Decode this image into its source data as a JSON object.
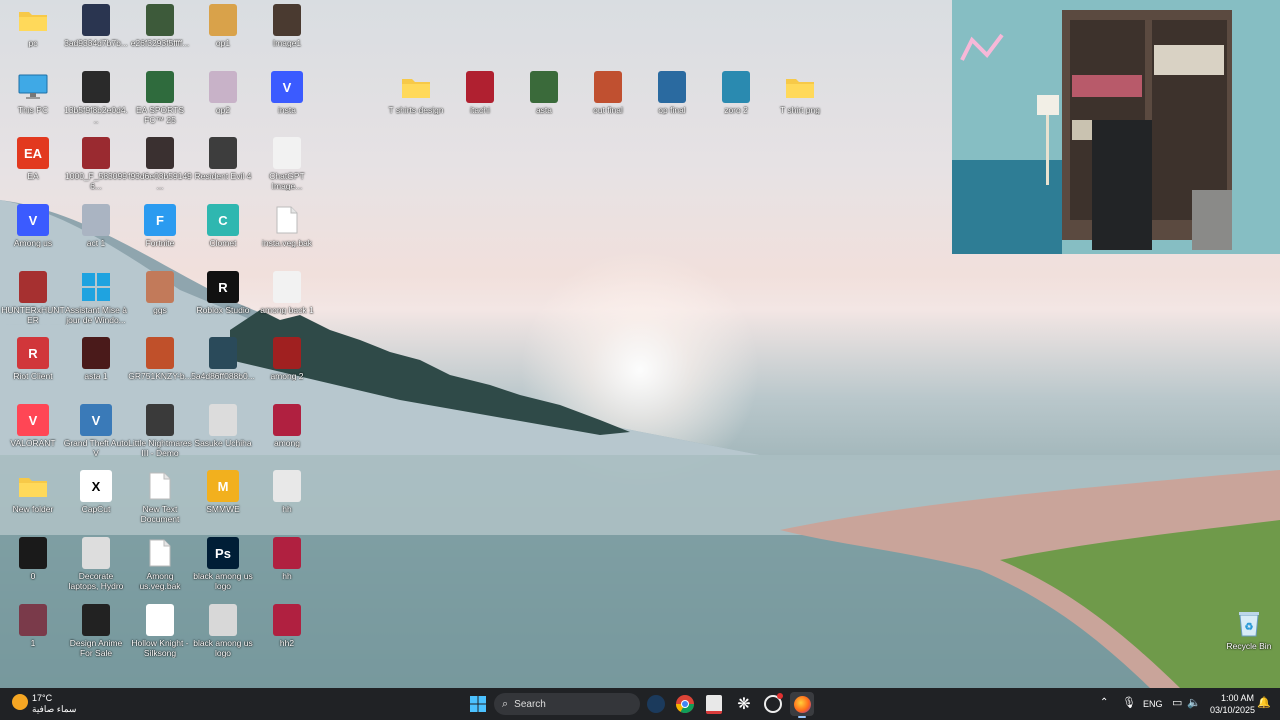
{
  "desktop": {
    "icons": [
      {
        "label": "pc",
        "type": "folder"
      },
      {
        "label": "3ad9334d7b7b...",
        "type": "image",
        "color": "#2a3550"
      },
      {
        "label": "e26f3293f5ffff...",
        "type": "image",
        "color": "#3d5a3a"
      },
      {
        "label": "op1",
        "type": "image",
        "color": "#d9a24a"
      },
      {
        "label": "Image1",
        "type": "image",
        "color": "#4a3a30"
      },
      {
        "label": "This PC",
        "type": "monitor"
      },
      {
        "label": "13b5f9f8b2e0d4...",
        "type": "image",
        "color": "#2a2a2a"
      },
      {
        "label": "EA SPORTS FC™ 25",
        "type": "image",
        "color": "#2f6b3d"
      },
      {
        "label": "op2",
        "type": "image",
        "color": "#c8b2c8"
      },
      {
        "label": "insta",
        "type": "v-app",
        "color": "#3b5bff"
      },
      {
        "label": "EA",
        "type": "app",
        "color": "#e2391f",
        "glyph": "EA"
      },
      {
        "label": "1000_F_5830996...",
        "type": "image",
        "color": "#9a2a30"
      },
      {
        "label": "f93d6e03b59149...",
        "type": "image",
        "color": "#3a3030"
      },
      {
        "label": "Resident Evil 4",
        "type": "image",
        "color": "#3d3d3d"
      },
      {
        "label": "ChatGPT Image...",
        "type": "image",
        "color": "#f2f2f2"
      },
      {
        "label": "Among us",
        "type": "v-app",
        "color": "#3b5bff"
      },
      {
        "label": "act 1",
        "type": "image",
        "color": "#aab4c2"
      },
      {
        "label": "Fortnite",
        "type": "app",
        "color": "#2b9bf0",
        "glyph": "F"
      },
      {
        "label": "Clomet",
        "type": "app",
        "color": "#2fb7b0",
        "glyph": "C"
      },
      {
        "label": "insta.veg.bak",
        "type": "file"
      },
      {
        "label": "HUNTERxHUNTER NENxIMPACT",
        "type": "image",
        "color": "#a63030"
      },
      {
        "label": "Assistant Mise à jour de Windo...",
        "type": "windows"
      },
      {
        "label": "ggs",
        "type": "image",
        "color": "#c27a5a"
      },
      {
        "label": "Roblox Studio",
        "type": "app",
        "color": "#111111",
        "glyph": "R"
      },
      {
        "label": "among back 1",
        "type": "image",
        "color": "#f2f2f2"
      },
      {
        "label": "Riot Client",
        "type": "app",
        "color": "#d1363a",
        "glyph": "R"
      },
      {
        "label": "asta 1",
        "type": "image",
        "color": "#4a1a1a"
      },
      {
        "label": "GR751KNZY-b...",
        "type": "image",
        "color": "#c0502a"
      },
      {
        "label": "5a4d86ff088b0...",
        "type": "image",
        "color": "#2a4a5a"
      },
      {
        "label": "among 2",
        "type": "image",
        "color": "#a02020"
      },
      {
        "label": "VALORANT",
        "type": "app",
        "color": "#ff4655",
        "glyph": "V"
      },
      {
        "label": "Grand Theft Auto V",
        "type": "app",
        "color": "#3a7ab8",
        "glyph": "V"
      },
      {
        "label": "Little Nightmares III - Demo",
        "type": "image",
        "color": "#3a3a3a"
      },
      {
        "label": "Sasuke Uchiha",
        "type": "image",
        "color": "#dcdcdc"
      },
      {
        "label": "among",
        "type": "image",
        "color": "#b02040"
      },
      {
        "label": "New folder",
        "type": "folder"
      },
      {
        "label": "CapCut",
        "type": "app",
        "color": "#ffffff",
        "glyph": "X"
      },
      {
        "label": "New Text Document",
        "type": "file"
      },
      {
        "label": "SMMWE",
        "type": "app",
        "color": "#f2b01e",
        "glyph": "M"
      },
      {
        "label": "hh",
        "type": "image",
        "color": "#e8e8e8"
      },
      {
        "label": "0",
        "type": "image",
        "color": "#1a1a1a"
      },
      {
        "label": "Decorate laptops, Hydro Flasks, c...",
        "type": "image",
        "color": "#dddddd"
      },
      {
        "label": "Among us.veg.bak",
        "type": "file"
      },
      {
        "label": "black among us logo",
        "type": "app",
        "color": "#001e36",
        "glyph": "Ps"
      },
      {
        "label": "hh",
        "type": "image",
        "color": "#b02040"
      },
      {
        "label": "1",
        "type": "image",
        "color": "#7a3a4a"
      },
      {
        "label": "Design Anime For Sale",
        "type": "image",
        "color": "#222222"
      },
      {
        "label": "Hollow Knight - Silksong",
        "type": "image",
        "color": "#ffffff"
      },
      {
        "label": "black among us logo",
        "type": "image",
        "color": "#d8d8d8"
      },
      {
        "label": "hh2",
        "type": "image",
        "color": "#b02040"
      }
    ],
    "top_row_icons": [
      {
        "label": "T shirts design",
        "type": "folder"
      },
      {
        "label": "itachi",
        "type": "image",
        "color": "#b02030"
      },
      {
        "label": "asta",
        "type": "image",
        "color": "#3a6a3a"
      },
      {
        "label": "out final",
        "type": "image",
        "color": "#c05030"
      },
      {
        "label": "op final",
        "type": "image",
        "color": "#2a6aa0"
      },
      {
        "label": "zoro 2",
        "type": "image",
        "color": "#2a8ab0"
      },
      {
        "label": "T shirt png",
        "type": "folder"
      }
    ],
    "recycle_bin_label": "Recycle Bin"
  },
  "taskbar": {
    "weather_temp": "17°C",
    "weather_desc": "سماء صافية",
    "search_placeholder": "Search",
    "language": "ENG",
    "time": "1:00 AM",
    "date": "03/10/2025",
    "apps": [
      "start-icon",
      "search",
      "steam-icon",
      "chrome-icon",
      "snipping-tool-icon",
      "chatgpt-icon",
      "opera-gx-icon",
      "firefox-icon"
    ]
  },
  "colors": {
    "taskbar_bg": "#202225",
    "accent": "#3b82f6"
  }
}
